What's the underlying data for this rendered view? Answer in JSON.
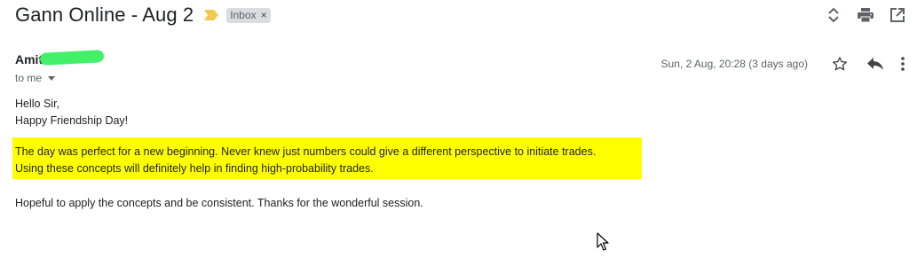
{
  "header": {
    "subject": "Gann Online - Aug 2",
    "label": "Inbox",
    "label_remove": "×",
    "icons": [
      "expand-collapse-icon",
      "print-icon",
      "open-in-new-window-icon"
    ]
  },
  "message": {
    "sender_name": "Amit",
    "recipient": "to me",
    "date": "Sun, 2 Aug, 20:28 (3 days ago)",
    "actions": [
      "star-icon",
      "reply-icon",
      "more-options-icon"
    ],
    "greeting": "Hello Sir,",
    "wish": "Happy Friendship Day!",
    "highlight_line1": "The day was perfect for a new beginning. Never knew just numbers could give a different perspective to initiate trades.",
    "highlight_line2": "Using these concepts will definitely help in finding high-probability trades.",
    "closing": "Hopeful to apply the concepts and be consistent. Thanks for the wonderful session."
  },
  "colors": {
    "highlight": "#ffff00",
    "importance_marker": "#f2c94c",
    "redaction": "#42f06a"
  }
}
